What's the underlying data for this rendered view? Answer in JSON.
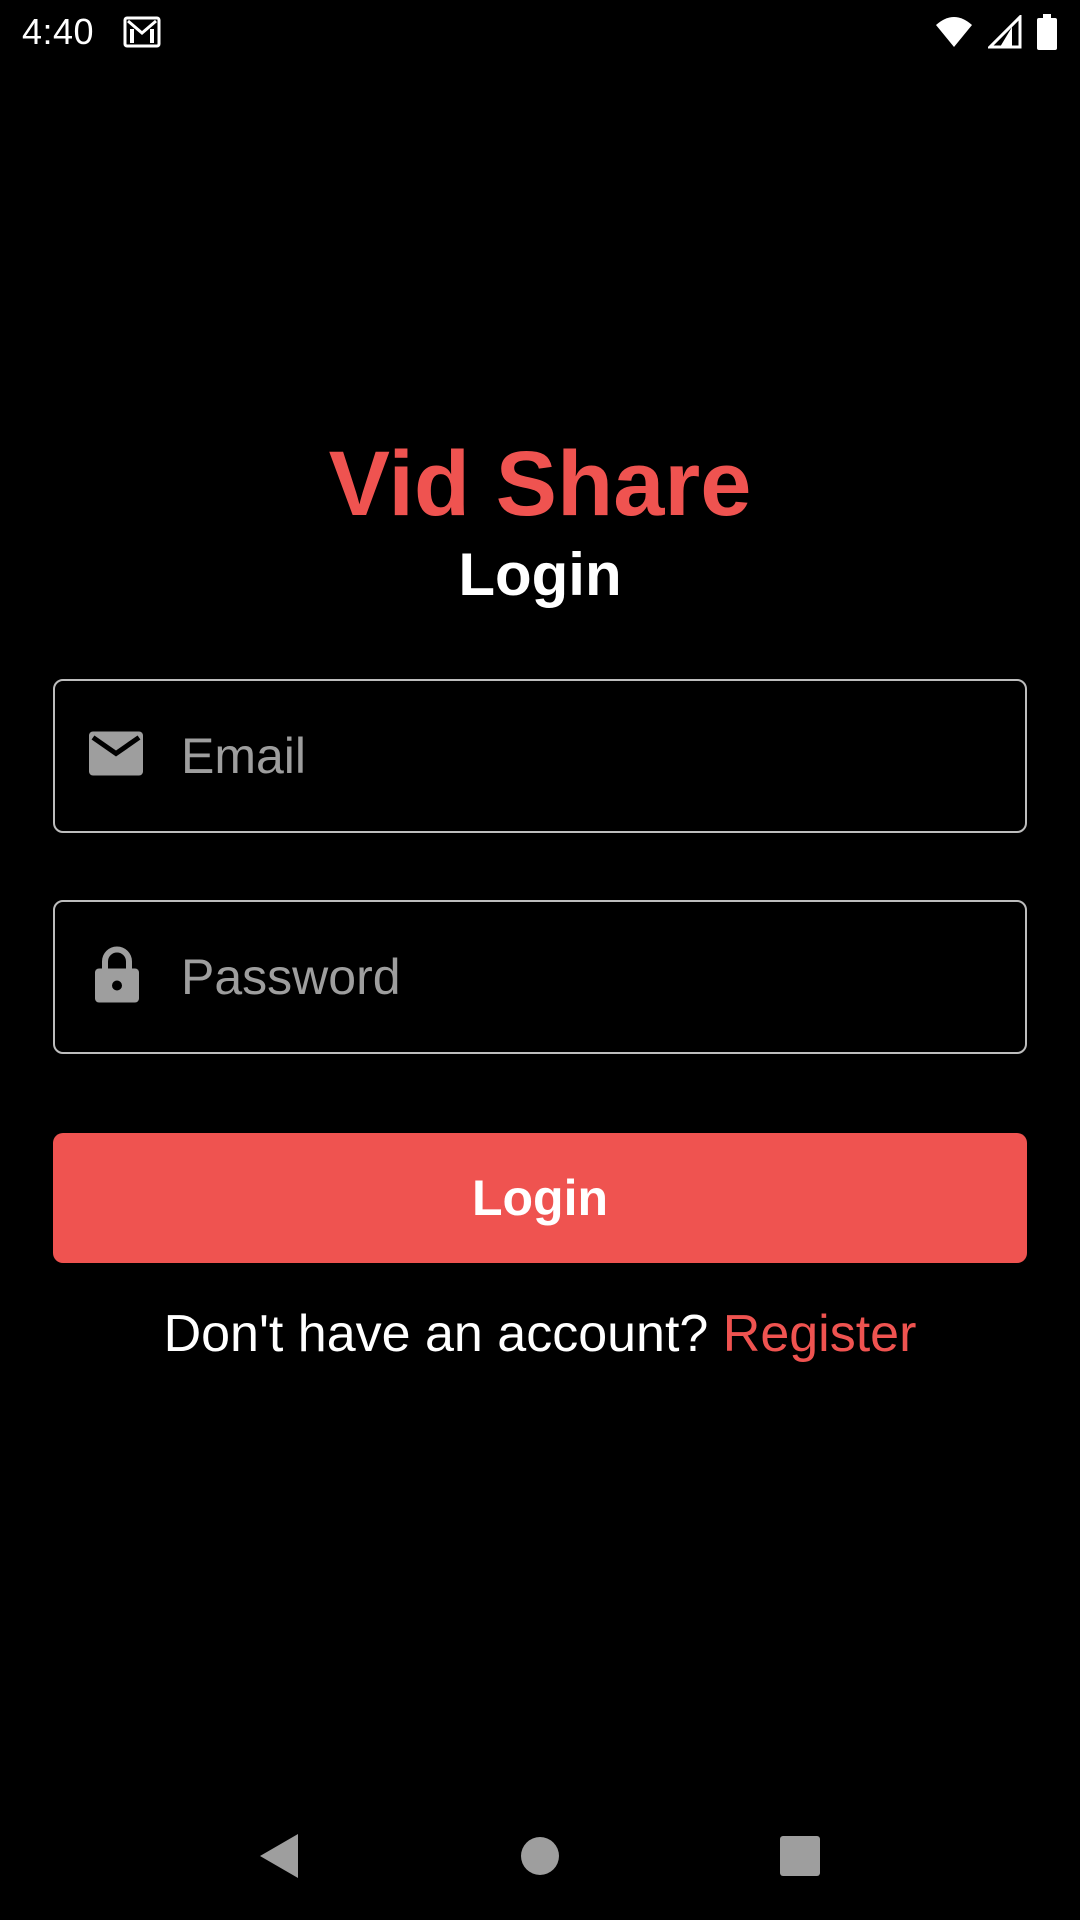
{
  "status_bar": {
    "time": "4:40",
    "icons": [
      "gmail-icon",
      "wifi-icon",
      "signal-icon",
      "battery-icon"
    ]
  },
  "app": {
    "title": "Vid Share",
    "subtitle": "Login"
  },
  "form": {
    "email": {
      "placeholder": "Email",
      "value": "",
      "icon": "mail-icon"
    },
    "password": {
      "placeholder": "Password",
      "value": "",
      "icon": "lock-icon"
    },
    "login_label": "Login"
  },
  "register": {
    "prompt": "Don't have an account? ",
    "link_label": "Register"
  },
  "nav_bar": {
    "icons": [
      "back-icon",
      "home-icon",
      "recents-icon"
    ]
  },
  "colors": {
    "accent": "#ef5350",
    "background": "#000000",
    "field_border": "#bdbdbd",
    "placeholder": "#9e9e9e",
    "text": "#ffffff"
  }
}
